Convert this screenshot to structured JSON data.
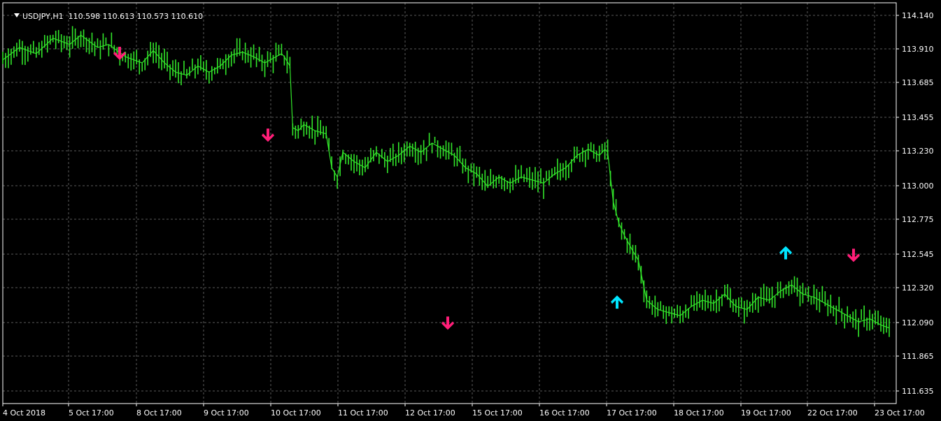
{
  "header": {
    "symbol_tf": "USDJPY,H1",
    "ohlc": "110.598 110.613 110.573 110.610"
  },
  "colors": {
    "background": "#000000",
    "grid": "#5a5a5a",
    "axis": "#ffffff",
    "price": "#32e62a",
    "sell_arrow": "#ff1e78",
    "buy_arrow": "#00e5ff"
  },
  "chart_data": {
    "type": "line",
    "title": "",
    "xlabel": "",
    "ylabel": "",
    "symbol": "USDJPY",
    "timeframe": "H1",
    "y_ticks": [
      "114.140",
      "113.910",
      "113.685",
      "113.455",
      "113.230",
      "113.000",
      "112.775",
      "112.545",
      "112.320",
      "112.090",
      "111.865",
      "111.635"
    ],
    "x_ticks": [
      "4 Oct 2018",
      "5 Oct 17:00",
      "8 Oct 17:00",
      "9 Oct 17:00",
      "10 Oct 17:00",
      "11 Oct 17:00",
      "12 Oct 17:00",
      "15 Oct 17:00",
      "16 Oct 17:00",
      "17 Oct 17:00",
      "18 Oct 17:00",
      "19 Oct 17:00",
      "22 Oct 17:00",
      "23 Oct 17:00"
    ],
    "ylim": [
      111.59,
      114.19
    ],
    "grid": true,
    "x_bars": 318,
    "series": [
      {
        "values": [
          [
            0,
            113.82
          ],
          [
            6,
            113.9
          ],
          [
            12,
            113.86
          ],
          [
            18,
            113.96
          ],
          [
            24,
            113.92
          ],
          [
            28,
            113.98
          ],
          [
            34,
            113.9
          ],
          [
            38,
            113.92
          ],
          [
            44,
            113.84
          ],
          [
            50,
            113.8
          ],
          [
            54,
            113.88
          ],
          [
            58,
            113.8
          ],
          [
            62,
            113.74
          ],
          [
            66,
            113.72
          ],
          [
            70,
            113.78
          ],
          [
            74,
            113.74
          ],
          [
            78,
            113.78
          ],
          [
            82,
            113.85
          ],
          [
            86,
            113.87
          ],
          [
            90,
            113.84
          ],
          [
            94,
            113.8
          ],
          [
            98,
            113.84
          ],
          [
            100,
            113.86
          ],
          [
            101,
            113.84
          ],
          [
            103,
            113.78
          ],
          [
            104,
            113.38
          ],
          [
            106,
            113.36
          ],
          [
            108,
            113.4
          ],
          [
            112,
            113.36
          ],
          [
            116,
            113.34
          ],
          [
            118,
            113.12
          ],
          [
            120,
            113.06
          ],
          [
            122,
            113.22
          ],
          [
            126,
            113.16
          ],
          [
            130,
            113.12
          ],
          [
            134,
            113.22
          ],
          [
            138,
            113.16
          ],
          [
            142,
            113.2
          ],
          [
            146,
            113.26
          ],
          [
            150,
            113.22
          ],
          [
            154,
            113.28
          ],
          [
            158,
            113.24
          ],
          [
            162,
            113.2
          ],
          [
            166,
            113.12
          ],
          [
            170,
            113.08
          ],
          [
            174,
            113.0
          ],
          [
            178,
            113.06
          ],
          [
            182,
            113.02
          ],
          [
            186,
            113.06
          ],
          [
            190,
            113.04
          ],
          [
            194,
            113.02
          ],
          [
            198,
            113.08
          ],
          [
            202,
            113.12
          ],
          [
            206,
            113.2
          ],
          [
            210,
            113.24
          ],
          [
            214,
            113.2
          ],
          [
            216,
            113.24
          ],
          [
            217,
            113.22
          ],
          [
            219,
            112.9
          ],
          [
            221,
            112.76
          ],
          [
            223,
            112.68
          ],
          [
            226,
            112.58
          ],
          [
            228,
            112.52
          ],
          [
            231,
            112.26
          ],
          [
            235,
            112.2
          ],
          [
            239,
            112.18
          ],
          [
            243,
            112.16
          ],
          [
            247,
            112.22
          ],
          [
            251,
            112.26
          ],
          [
            255,
            112.24
          ],
          [
            259,
            112.3
          ],
          [
            263,
            112.22
          ],
          [
            267,
            112.2
          ],
          [
            271,
            112.28
          ],
          [
            275,
            112.26
          ],
          [
            279,
            112.32
          ],
          [
            283,
            112.36
          ],
          [
            287,
            112.3
          ],
          [
            291,
            112.28
          ],
          [
            295,
            112.24
          ],
          [
            299,
            112.2
          ],
          [
            303,
            112.16
          ],
          [
            307,
            112.12
          ],
          [
            311,
            112.14
          ],
          [
            315,
            112.1
          ],
          [
            318,
            112.08
          ]
        ]
      }
    ],
    "signals": [
      {
        "type": "sell",
        "price": 113.85
      },
      {
        "type": "sell",
        "price": 113.32
      },
      {
        "type": "sell",
        "price": 112.1
      },
      {
        "type": "buy",
        "price": 112.26
      },
      {
        "type": "buy",
        "price": 112.58
      },
      {
        "type": "sell",
        "price": 112.54
      }
    ]
  }
}
